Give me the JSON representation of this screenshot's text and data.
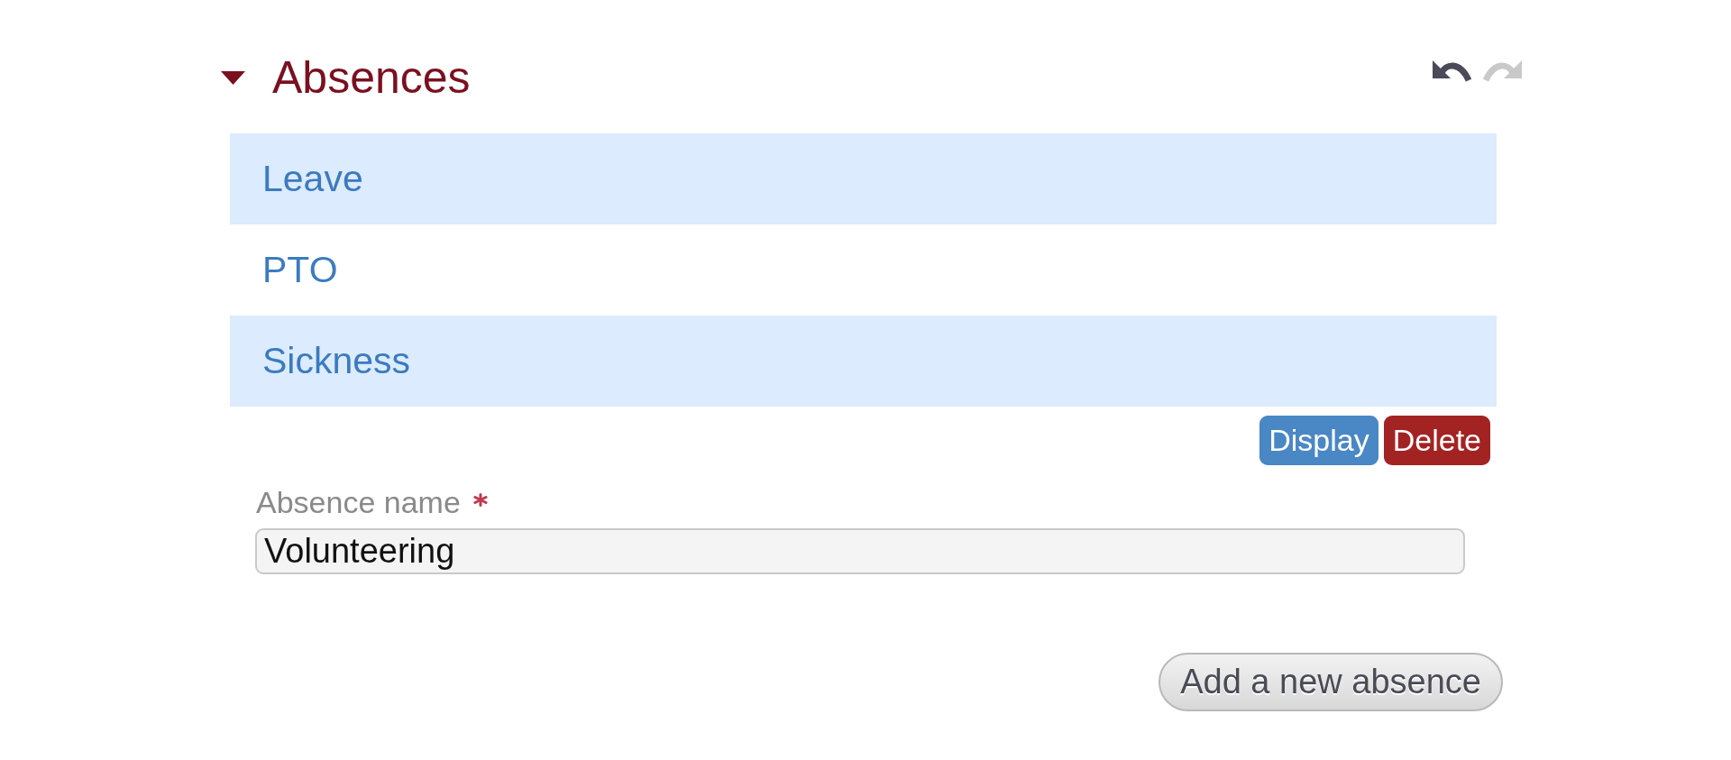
{
  "section": {
    "title": "Absences",
    "expanded": true
  },
  "toolbar": [
    {
      "kind": "undo",
      "disabled": false
    },
    {
      "kind": "redo",
      "disabled": true
    }
  ],
  "list": {
    "items": [
      {
        "label": "Leave"
      },
      {
        "label": "PTO"
      },
      {
        "label": "Sickness"
      }
    ]
  },
  "actions": [
    {
      "kind": "primary",
      "label": "Display"
    },
    {
      "kind": "danger",
      "label": "Delete"
    }
  ],
  "field": {
    "label": "Absence name",
    "required": true,
    "value": "Volunteering"
  },
  "add_button": {
    "label": "Add a new absence"
  }
}
